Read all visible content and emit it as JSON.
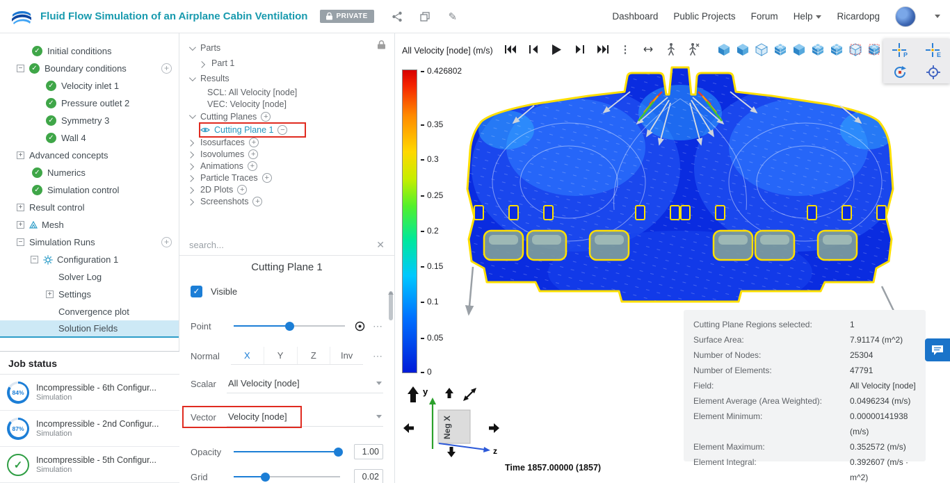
{
  "header": {
    "title": "Fluid Flow Simulation of an Airplane Cabin Ventilation",
    "privacy_badge": "PRIVATE",
    "nav": {
      "dashboard": "Dashboard",
      "public_projects": "Public Projects",
      "forum": "Forum",
      "help": "Help",
      "username": "Ricardopg"
    }
  },
  "sim_tree": {
    "items": [
      {
        "label": "Initial conditions"
      },
      {
        "label": "Boundary conditions"
      },
      {
        "label": "Velocity inlet 1"
      },
      {
        "label": "Pressure outlet 2"
      },
      {
        "label": "Symmetry 3"
      },
      {
        "label": "Wall 4"
      },
      {
        "label": "Advanced concepts"
      },
      {
        "label": "Numerics"
      },
      {
        "label": "Simulation control"
      },
      {
        "label": "Result control"
      },
      {
        "label": "Mesh"
      },
      {
        "label": "Simulation Runs"
      },
      {
        "label": "Configuration 1"
      },
      {
        "label": "Solver Log"
      },
      {
        "label": "Settings"
      },
      {
        "label": "Convergence plot"
      },
      {
        "label": "Solution Fields"
      }
    ]
  },
  "job_status": {
    "title": "Job status",
    "jobs": [
      {
        "progress": "84%",
        "name": "Incompressible - 6th Configur...",
        "type": "Simulation",
        "state": "running"
      },
      {
        "progress": "87%",
        "name": "Incompressible - 2nd Configur...",
        "type": "Simulation",
        "state": "running"
      },
      {
        "progress": "100%",
        "name": "Incompressible - 5th Configur...",
        "type": "Simulation",
        "state": "completed"
      }
    ]
  },
  "post_tree": {
    "parts": "Parts",
    "part1": "Part 1",
    "results": "Results",
    "scl": "SCL: All Velocity [node]",
    "vec": "VEC: Velocity [node]",
    "cutting_planes": "Cutting Planes",
    "cutting_plane_1": "Cutting Plane 1",
    "isosurfaces": "Isosurfaces",
    "isovolumes": "Isovolumes",
    "animations": "Animations",
    "particle_traces": "Particle Traces",
    "plots_2d": "2D Plots",
    "screenshots": "Screenshots",
    "search_placeholder": "search..."
  },
  "properties": {
    "title": "Cutting Plane 1",
    "visible_label": "Visible",
    "point_label": "Point",
    "normal_label": "Normal",
    "normal_buttons": [
      "X",
      "Y",
      "Z",
      "Inv"
    ],
    "scalar_label": "Scalar",
    "scalar_value": "All Velocity [node]",
    "vector_label": "Vector",
    "vector_value": "Velocity [node]",
    "opacity_label": "Opacity",
    "opacity_value": "1.00",
    "grid_label": "Grid",
    "grid_value": "0.02"
  },
  "viewport": {
    "field_label": "All Velocity [node] (m/s)",
    "time_label": "Time 1857.00000 (1857)",
    "legend_ticks": [
      "0.426802",
      "0.35",
      "0.3",
      "0.25",
      "0.2",
      "0.15",
      "0.1",
      "0.05",
      "0"
    ],
    "triad": {
      "cube_label": "Neg X",
      "y_label": "y",
      "z_label": "z"
    }
  },
  "info_panel": {
    "rows": [
      {
        "label": "Cutting Plane Regions selected:",
        "value": "1"
      },
      {
        "label": "Surface Area:",
        "value": "7.91174 (m^2)"
      },
      {
        "label": "Number of Nodes:",
        "value": "25304"
      },
      {
        "label": "Number of Elements:",
        "value": "47791"
      },
      {
        "label": "Field:",
        "value": "All Velocity [node]"
      },
      {
        "label": "Element Average (Area Weighted):",
        "value": "0.0496234 (m/s)"
      },
      {
        "label": "Element Minimum:",
        "value": "0.00000141938 (m/s)"
      },
      {
        "label": "Element Maximum:",
        "value": "0.352572 (m/s)"
      },
      {
        "label": "Element Integral:",
        "value": "0.392607 (m/s · m^2)"
      }
    ]
  },
  "colors": {
    "brand_teal": "#189aae",
    "accent_blue": "#1c7ed6",
    "success_green": "#3fa648",
    "annotation_red": "#e02b20",
    "selection_bg": "#cde9f6"
  }
}
